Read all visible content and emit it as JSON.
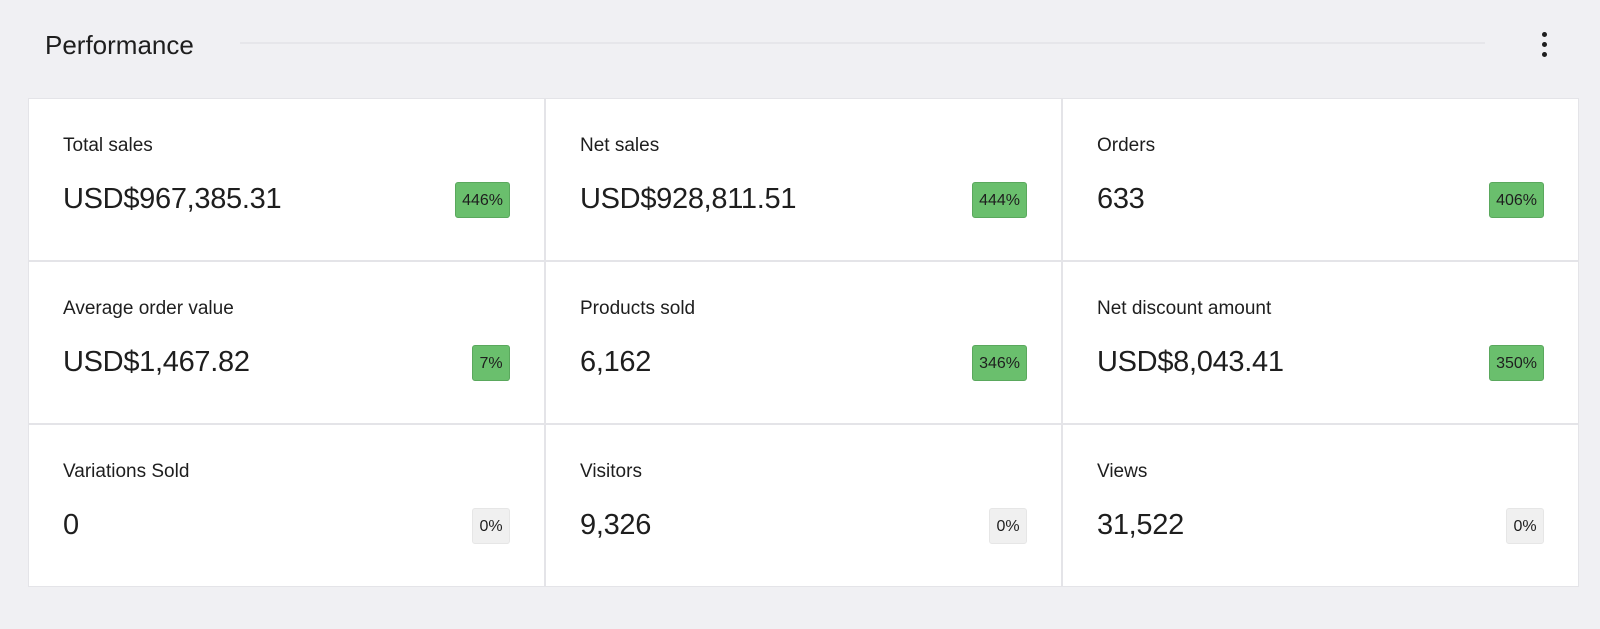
{
  "header": {
    "title": "Performance",
    "more_icon": "vertical-ellipsis-icon"
  },
  "colors": {
    "badge_positive": "#6abf6d",
    "badge_neutral": "#f0f0f0",
    "background": "#f0f0f3",
    "card": "#ffffff"
  },
  "metrics": [
    {
      "label": "Total sales",
      "value": "USD$967,385.31",
      "change": "446%",
      "status": "positive"
    },
    {
      "label": "Net sales",
      "value": "USD$928,811.51",
      "change": "444%",
      "status": "positive"
    },
    {
      "label": "Orders",
      "value": "633",
      "change": "406%",
      "status": "positive"
    },
    {
      "label": "Average order value",
      "value": "USD$1,467.82",
      "change": "7%",
      "status": "positive"
    },
    {
      "label": "Products sold",
      "value": "6,162",
      "change": "346%",
      "status": "positive"
    },
    {
      "label": "Net discount amount",
      "value": "USD$8,043.41",
      "change": "350%",
      "status": "positive"
    },
    {
      "label": "Variations Sold",
      "value": "0",
      "change": "0%",
      "status": "neutral"
    },
    {
      "label": "Visitors",
      "value": "9,326",
      "change": "0%",
      "status": "neutral"
    },
    {
      "label": "Views",
      "value": "31,522",
      "change": "0%",
      "status": "neutral"
    }
  ]
}
